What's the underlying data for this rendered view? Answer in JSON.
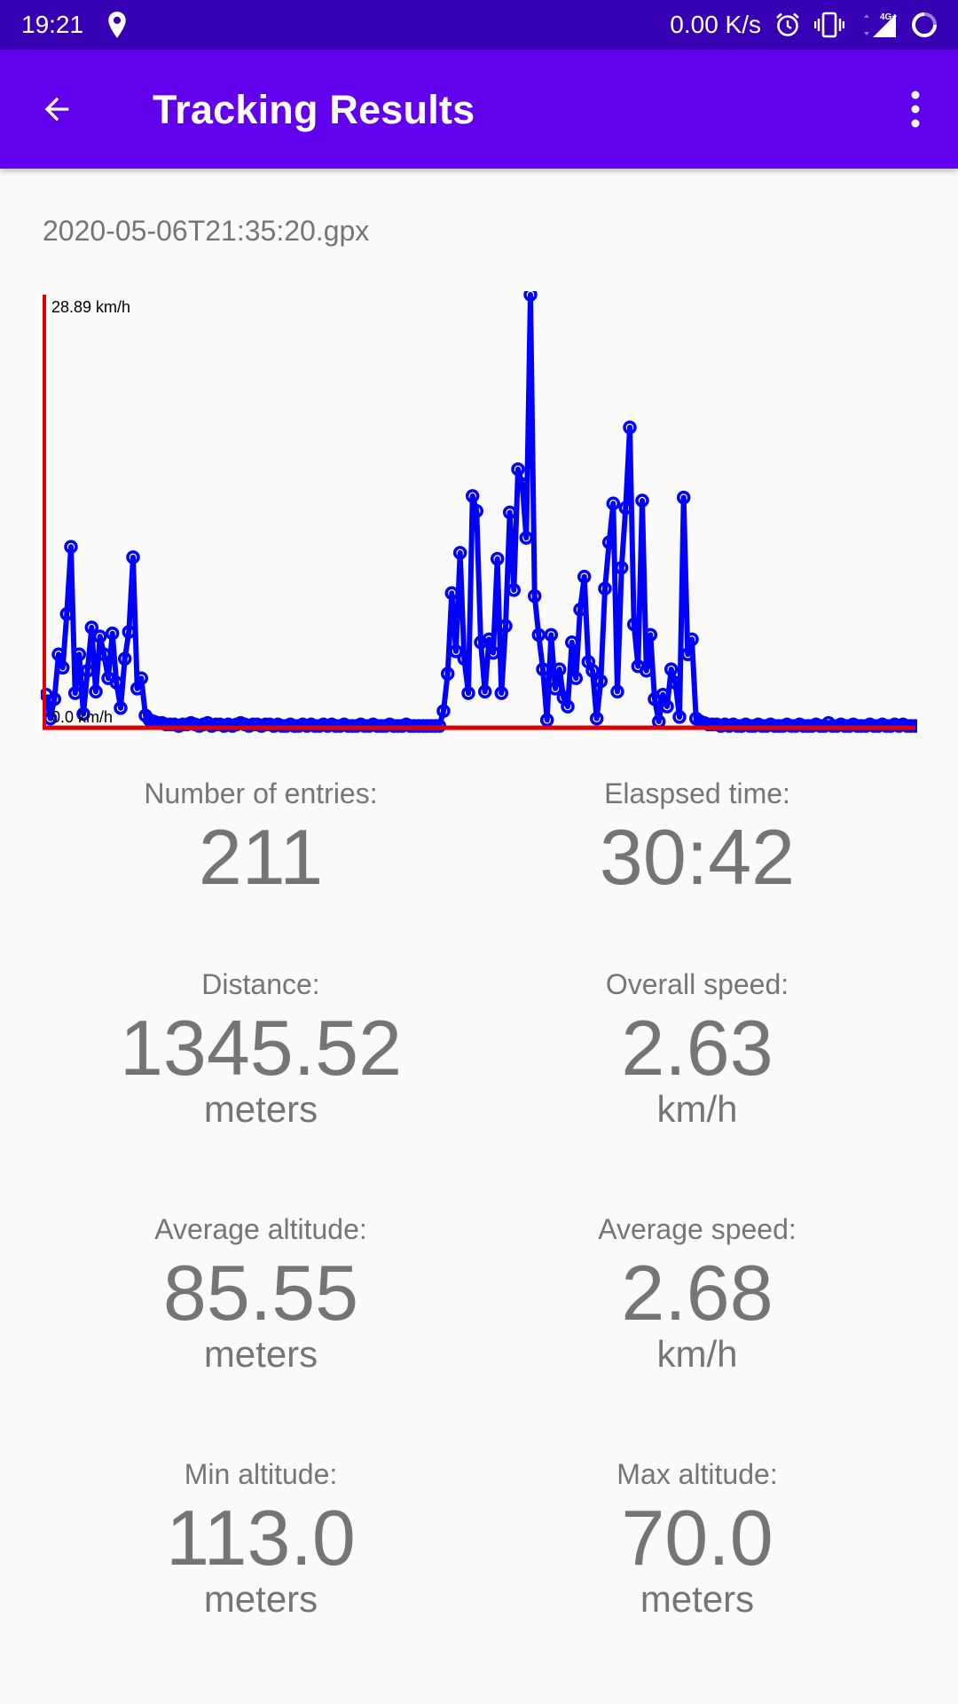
{
  "status_bar": {
    "time": "19:21",
    "network_speed": "0.00 K/s",
    "network_type": "4G+",
    "icons": [
      "location-icon",
      "alarm-icon",
      "vibrate-icon",
      "signal-icon",
      "loading-circle-icon"
    ]
  },
  "app_bar": {
    "title": "Tracking Results",
    "back_icon": "arrow-back-icon",
    "more_icon": "more-vert-icon",
    "color": "#6200ee"
  },
  "file_name": "2020-05-06T21:35:20.gpx",
  "chart_data": {
    "type": "line",
    "title": "",
    "xlabel": "",
    "ylabel": "",
    "y_max_label": "28.89 km/h",
    "y_min_label": "0.0 km/h",
    "ylim": [
      0,
      28.89
    ],
    "axis_color": "#e00000",
    "series_color": "#0000ff",
    "grid": false,
    "series": [
      {
        "values": [
          2.1,
          0.5,
          1.8,
          4.8,
          3.9,
          7.5,
          12.0,
          2.2,
          4.8,
          0.8,
          3.7,
          6.6,
          2.3,
          6.0,
          4.8,
          3.2,
          6.2,
          2.9,
          1.2,
          4.5,
          6.3,
          11.3,
          2.5,
          3.2,
          0.7,
          0.4,
          0.3,
          0.2,
          0.2,
          0.1,
          0.1,
          0.1,
          0.0,
          0.1,
          0.1,
          0.2,
          0.1,
          0.0,
          0.1,
          0.2,
          0.0,
          0.1,
          0.1,
          0.0,
          0.1,
          0.0,
          0.1,
          0.2,
          0.1,
          0.0,
          0.1,
          0.1,
          0.0,
          0.1,
          0.1,
          0.0,
          0.1,
          0.0,
          0.0,
          0.1,
          0.0,
          0.0,
          0.1,
          0.0,
          0.1,
          0.0,
          0.0,
          0.1,
          0.0,
          0.1,
          0.0,
          0.0,
          0.1,
          0.0,
          0.0,
          0.0,
          0.1,
          0.0,
          0.0,
          0.1,
          0.0,
          0.0,
          0.0,
          0.1,
          0.0,
          0.0,
          0.0,
          0.1,
          0.0,
          0.0,
          0.0,
          0.0,
          0.0,
          0.0,
          0.0,
          0.0,
          1.0,
          3.5,
          8.9,
          5.0,
          11.6,
          4.5,
          2.2,
          15.4,
          14.4,
          5.6,
          2.3,
          5.8,
          4.9,
          11.2,
          2.2,
          6.7,
          14.3,
          9.1,
          17.2,
          16.2,
          12.6,
          28.89,
          8.7,
          6.1,
          3.8,
          0.4,
          6.1,
          2.5,
          3.8,
          1.9,
          1.3,
          5.6,
          3.2,
          7.8,
          10.0,
          4.3,
          3.7,
          0.5,
          3.0,
          9.2,
          12.3,
          14.9,
          2.3,
          10.6,
          14.6,
          20.0,
          6.8,
          4.0,
          15.1,
          3.7,
          6.1,
          1.8,
          0.3,
          2.1,
          1.3,
          3.8,
          2.9,
          0.6,
          15.3,
          4.8,
          5.8,
          0.5,
          0.3,
          0.2,
          0.1,
          0.1,
          0.1,
          0.0,
          0.1,
          0.0,
          0.1,
          0.0,
          0.0,
          0.1,
          0.0,
          0.0,
          0.1,
          0.0,
          0.0,
          0.1,
          0.0,
          0.0,
          0.0,
          0.1,
          0.0,
          0.0,
          0.1,
          0.0,
          0.0,
          0.0,
          0.1,
          0.0,
          0.0,
          0.2,
          0.0,
          0.0,
          0.1,
          0.0,
          0.0,
          0.1,
          0.0,
          0.0,
          0.0,
          0.1,
          0.0,
          0.0,
          0.1,
          0.0,
          0.0,
          0.1,
          0.0,
          0.1,
          0.0,
          0.0,
          0.0
        ]
      }
    ]
  },
  "stats": [
    {
      "label": "Number of entries:",
      "value": "211",
      "unit": ""
    },
    {
      "label": "Elaspsed time:",
      "value": "30:42",
      "unit": ""
    },
    {
      "label": "Distance:",
      "value": "1345.52",
      "unit": "meters"
    },
    {
      "label": "Overall speed:",
      "value": "2.63",
      "unit": "km/h"
    },
    {
      "label": "Average altitude:",
      "value": "85.55",
      "unit": "meters"
    },
    {
      "label": "Average speed:",
      "value": "2.68",
      "unit": "km/h"
    },
    {
      "label": "Min altitude:",
      "value": "113.0",
      "unit": "meters"
    },
    {
      "label": "Max altitude:",
      "value": "70.0",
      "unit": "meters"
    }
  ]
}
